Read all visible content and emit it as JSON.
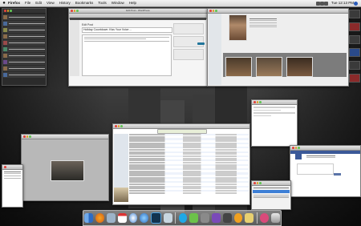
{
  "menubar": {
    "app_name": "Firefox",
    "items": [
      "File",
      "Edit",
      "View",
      "History",
      "Bookmarks",
      "Tools",
      "Window",
      "Help"
    ],
    "clock": "Tue 12:13 PM"
  },
  "editor": {
    "title": "Edit Post ‹ WordPress",
    "page_heading": "Edit Post",
    "post_title": "Holiday Countdown: Kiss Your Voice ...",
    "publish_color": "#21759b"
  },
  "dock": {
    "icons": [
      "finder-icon",
      "firefox-icon",
      "mail-icon",
      "ical-icon",
      "safari-icon",
      "itunes-icon",
      "photoshop-icon",
      "preview-icon",
      "skype-icon",
      "chat-icon",
      "system-prefs-icon",
      "app-store-icon",
      "camera-icon",
      "adium-icon",
      "stickies-icon",
      "downloads-icon",
      "trash-icon"
    ]
  },
  "colors": {
    "facebook_blue": "#3b5998",
    "selection_blue": "#3d7fd6"
  }
}
